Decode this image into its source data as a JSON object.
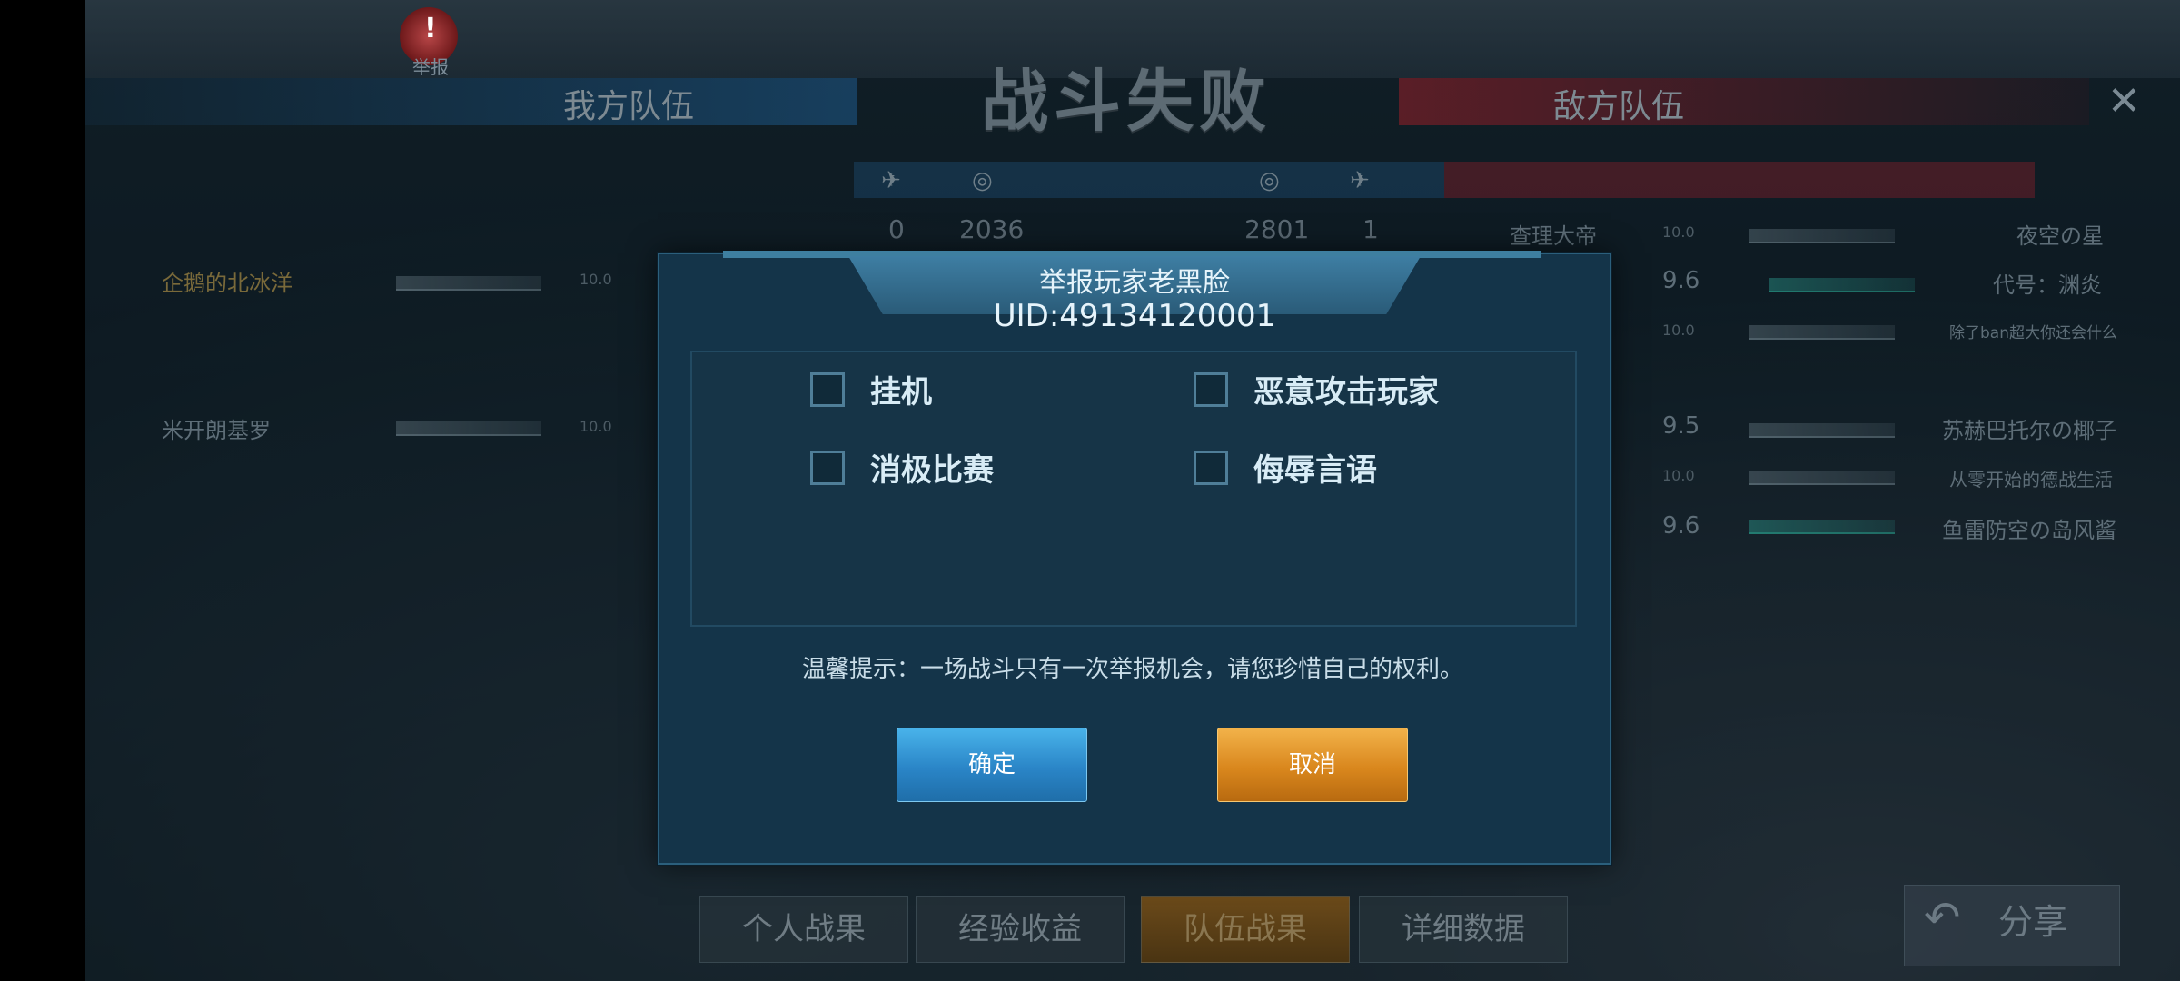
{
  "header": {
    "result_title": "战斗失败",
    "small_label_left": "举报",
    "team_left": "我方队伍",
    "team_right": "敌方队伍",
    "close": "✕"
  },
  "scoreboard": {
    "left_kills": "0",
    "left_score": "2036",
    "right_score": "2801",
    "right_kills": "1"
  },
  "left_roster": [
    {
      "name": "企鹅的北冰洋",
      "score": "10.0"
    },
    {
      "name": "米开朗基罗",
      "score": "10.0"
    }
  ],
  "right_roster": [
    {
      "name": "夜空の星",
      "score": "10.0"
    },
    {
      "name": "代号：渊炎",
      "score": "9.6"
    },
    {
      "name": "除了ban超大你还会什么",
      "score": "10.0"
    },
    {
      "name": "苏赫巴托尔の椰子",
      "score": "9.5"
    },
    {
      "name": "从零开始的德战生活",
      "score": "10.0"
    },
    {
      "name": "鱼雷防空の岛风酱",
      "score": "9.6"
    }
  ],
  "right_captain": "查理大帝",
  "dialog": {
    "title": "举报玩家老黑脸",
    "uid": "UID:49134120001",
    "options": [
      "挂机",
      "恶意攻击玩家",
      "消极比赛",
      "侮辱言语"
    ],
    "tip": "温馨提示：一场战斗只有一次举报机会，请您珍惜自己的权利。",
    "confirm": "确定",
    "cancel": "取消"
  },
  "tabs": [
    "个人战果",
    "经验收益",
    "队伍战果",
    "详细数据"
  ],
  "share": "分享",
  "colors": {
    "dialog_bg": "#143449",
    "confirm_button": "#2a85c7",
    "cancel_button": "#d9871d"
  }
}
